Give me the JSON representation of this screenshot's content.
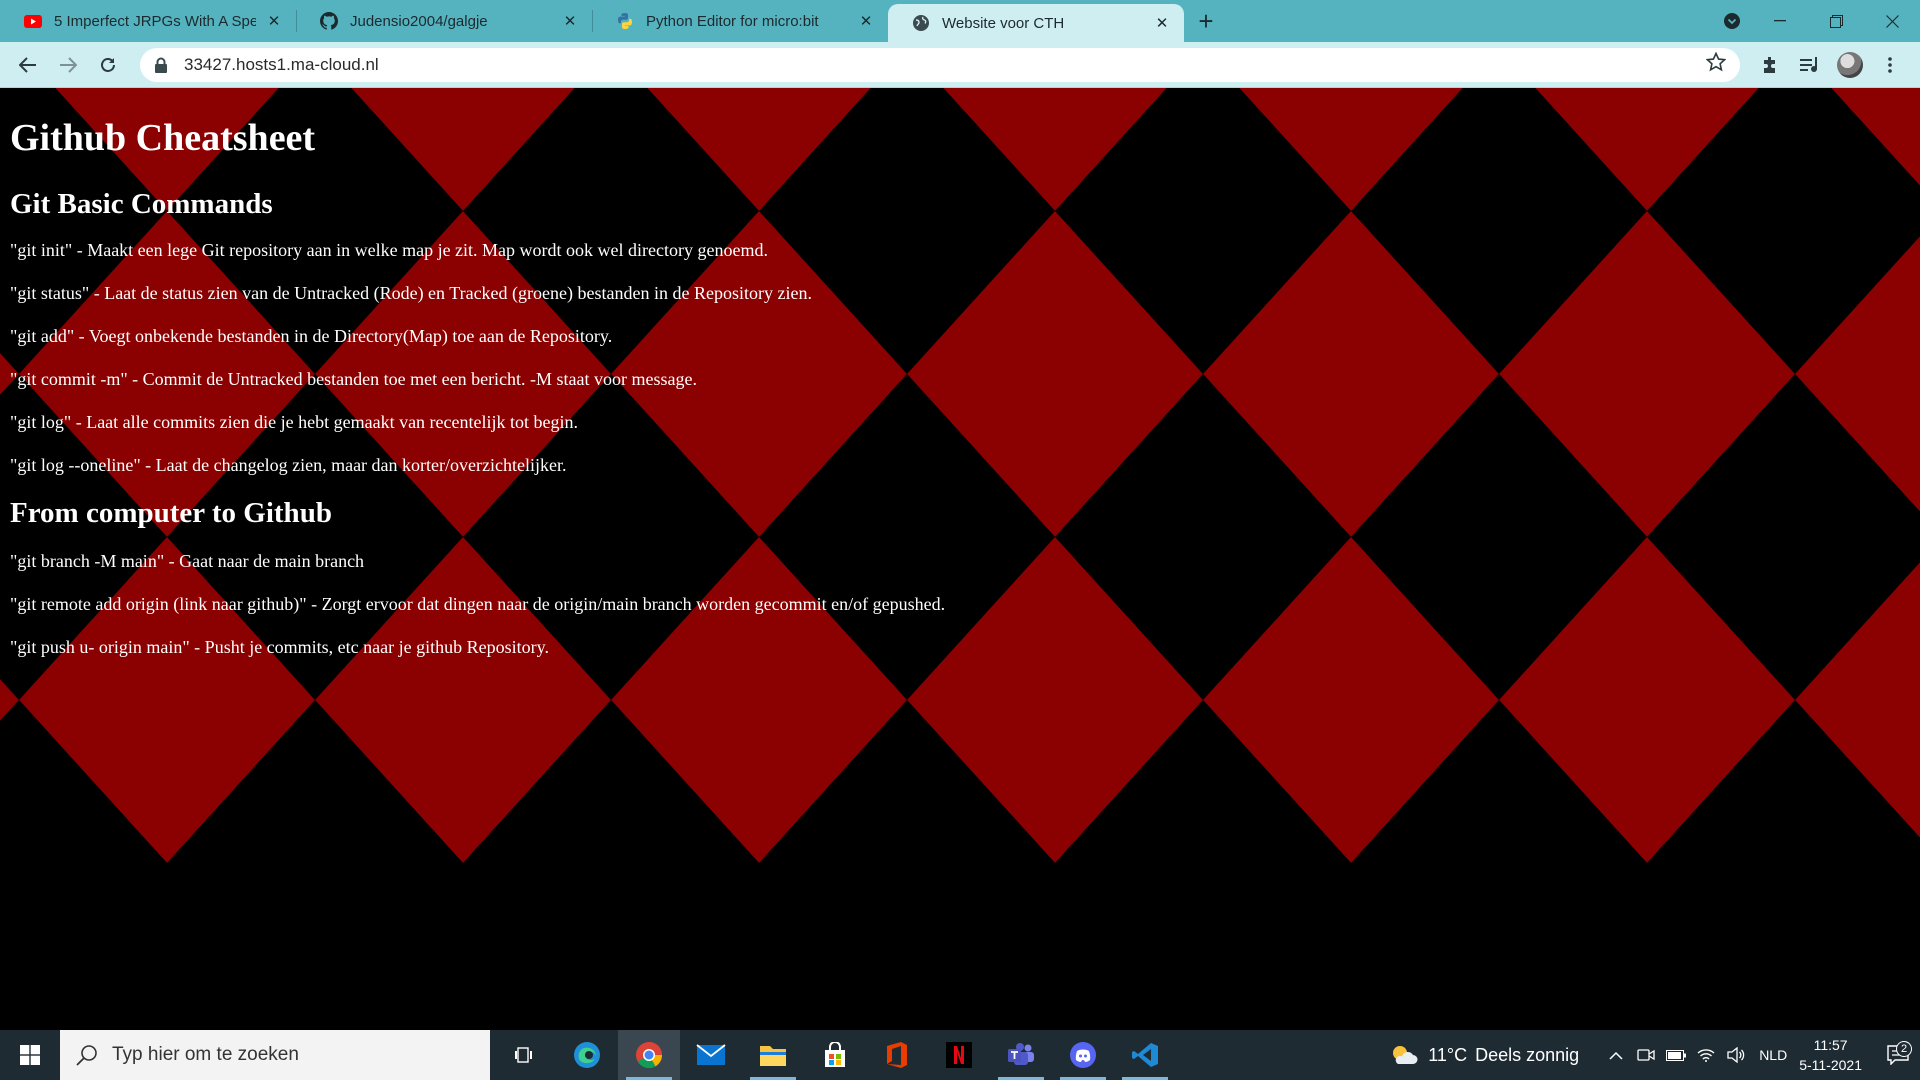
{
  "browser": {
    "tabs": [
      {
        "title": "5 Imperfect JRPGs With A Special",
        "icon": "youtube-icon",
        "active": false
      },
      {
        "title": "Judensio2004/galgje",
        "icon": "github-icon",
        "active": false
      },
      {
        "title": "Python Editor for micro:bit",
        "icon": "python-icon",
        "active": false
      },
      {
        "title": "Website voor CTH",
        "icon": "globe-icon",
        "active": true
      }
    ],
    "tab_close_glyph": "✕",
    "new_tab_glyph": "+",
    "url": "33427.hosts1.ma-cloud.nl",
    "colors": {
      "tabstrip": "#55b3c0",
      "toolbar": "#cfeef2"
    }
  },
  "page": {
    "title": "Github Cheatsheet",
    "sections": [
      {
        "heading": "Git Basic Commands",
        "items": [
          "\"git init\" - Maakt een lege Git repository aan in welke map je zit. Map wordt ook wel directory genoemd.",
          "\"git status\" - Laat de status zien van de Untracked (Rode) en Tracked (groene) bestanden in de Repository zien.",
          "\"git add\" - Voegt onbekende bestanden in de Directory(Map) toe aan de Repository.",
          "\"git commit -m\" - Commit de Untracked bestanden toe met een bericht. -M staat voor message.",
          "\"git log\" - Laat alle commits zien die je hebt gemaakt van recentelijk tot begin.",
          "\"git log --oneline\" - Laat de changelog zien, maar dan korter/overzichtelijker."
        ]
      },
      {
        "heading": "From computer to Github",
        "items": [
          "\"git branch -M main\" - Gaat naar de main branch",
          "\"git remote add origin (link naar github)\" - Zorgt ervoor dat dingen naar de origin/main branch worden gecommit en/of gepushed.",
          "\"git push u- origin main\" - Pusht je commits, etc naar je github Repository."
        ]
      }
    ],
    "colors": {
      "diamond_red": "#8b0000",
      "diamond_black": "#000000",
      "text": "#ffffff"
    }
  },
  "taskbar": {
    "search_placeholder": "Typ hier om te zoeken",
    "apps": [
      {
        "name": "task-view-icon"
      },
      {
        "name": "edge-icon"
      },
      {
        "name": "chrome-icon",
        "active": true
      },
      {
        "name": "mail-icon"
      },
      {
        "name": "file-explorer-icon"
      },
      {
        "name": "store-icon"
      },
      {
        "name": "office-icon"
      },
      {
        "name": "netflix-icon"
      },
      {
        "name": "teams-icon"
      },
      {
        "name": "discord-icon"
      },
      {
        "name": "vscode-icon"
      }
    ],
    "weather": {
      "temp": "11°C",
      "text": "Deels zonnig"
    },
    "language": "NLD",
    "time": "11:57",
    "date": "5-11-2021",
    "notification_count": "2"
  }
}
